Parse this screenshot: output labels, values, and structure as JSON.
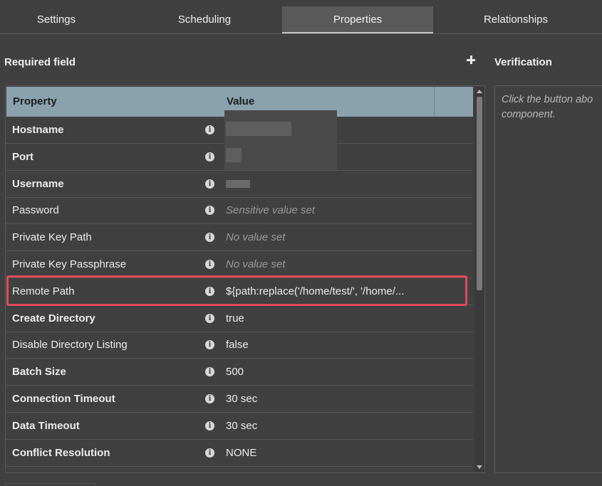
{
  "tabs": [
    {
      "label": "Settings",
      "active": false
    },
    {
      "label": "Scheduling",
      "active": false
    },
    {
      "label": "Properties",
      "active": true
    },
    {
      "label": "Relationships",
      "active": false
    }
  ],
  "required_field_label": "Required field",
  "verification": {
    "title": "Verification",
    "hint": "Click the button abo\ncomponent."
  },
  "table": {
    "headers": {
      "property": "Property",
      "value": "Value"
    },
    "rows": [
      {
        "name": "Hostname",
        "bold": true,
        "value": ""
      },
      {
        "name": "Port",
        "bold": true,
        "value": ""
      },
      {
        "name": "Username",
        "bold": true,
        "value": ""
      },
      {
        "name": "Password",
        "bold": false,
        "value": "Sensitive value set",
        "placeholder": true
      },
      {
        "name": "Private Key Path",
        "bold": false,
        "value": "No value set",
        "placeholder": true
      },
      {
        "name": "Private Key Passphrase",
        "bold": false,
        "value": "No value set",
        "placeholder": true
      },
      {
        "name": "Remote Path",
        "bold": false,
        "value": "${path:replace('/home/test/', '/home/...",
        "highlighted": true
      },
      {
        "name": "Create Directory",
        "bold": true,
        "value": "true"
      },
      {
        "name": "Disable Directory Listing",
        "bold": false,
        "value": "false"
      },
      {
        "name": "Batch Size",
        "bold": true,
        "value": "500"
      },
      {
        "name": "Connection Timeout",
        "bold": true,
        "value": "30 sec"
      },
      {
        "name": "Data Timeout",
        "bold": true,
        "value": "30 sec"
      },
      {
        "name": "Conflict Resolution",
        "bold": true,
        "value": "NONE"
      }
    ]
  },
  "icons": {
    "add": "plus-icon",
    "info": "info-icon"
  },
  "colors": {
    "header_bg": "#8aa2ad",
    "highlight_border": "#e24a5a",
    "background": "#404040"
  }
}
